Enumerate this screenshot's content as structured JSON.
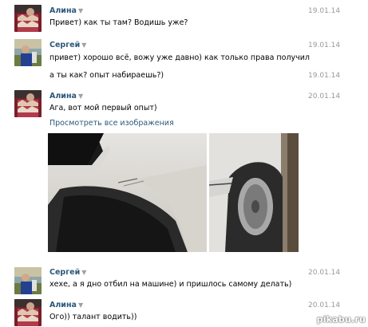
{
  "messages": [
    {
      "author": "Алина",
      "date": "19.01.14",
      "lines": [
        "Привет) как ты там? Водишь уже?"
      ]
    },
    {
      "author": "Сергей",
      "date": "19.01.14",
      "lines": [
        "привет) хорошо всё, вожу уже давно) как только права получил"
      ]
    },
    {
      "author": "",
      "date": "19.01.14",
      "lines": [
        "а ты как? опыт набираешь?)"
      ]
    },
    {
      "author": "Алина",
      "date": "20.01.14",
      "lines": [
        "Ага, вот мой первый опыт)"
      ],
      "link": "Просмотреть все изображения"
    },
    {
      "author": "Сергей",
      "date": "20.01.14",
      "lines": [
        "хехе, а я дно отбил на машине) и пришлось самому делать)"
      ]
    },
    {
      "author": "Алина",
      "date": "20.01.14",
      "lines": [
        "Ого)) талант водить))"
      ]
    }
  ],
  "caret": "▼",
  "watermark": "pikabu.ru",
  "icons": {
    "avatar_alina": "avatar-photo",
    "avatar_sergey": "avatar-photo"
  }
}
